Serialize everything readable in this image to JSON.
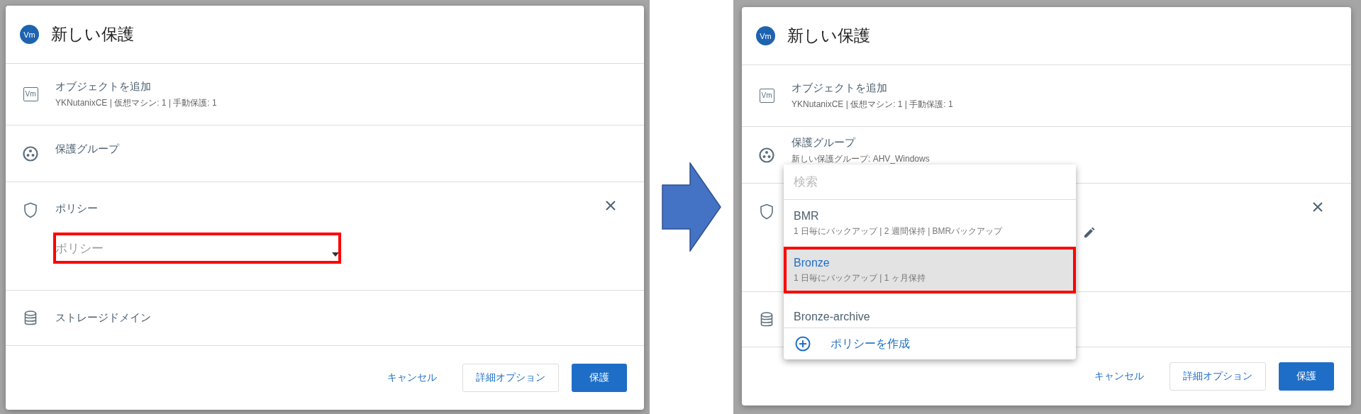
{
  "panels": [
    {
      "title": "新しい保護",
      "avatar": "Vm",
      "sections": [
        {
          "kind": "object",
          "badge": "Vm",
          "title": "オブジェクトを追加",
          "subtitle": "YKNutanixCE  |  仮想マシン: 1  |  手動保護: 1"
        },
        {
          "kind": "group",
          "title": "保護グループ"
        },
        {
          "kind": "policy",
          "title": "ポリシー",
          "closable": true,
          "field": {
            "placeholder": "ポリシー",
            "highlighted": true
          }
        },
        {
          "kind": "storage",
          "title": "ストレージドメイン"
        }
      ],
      "buttons": [
        {
          "label": "キャンセル",
          "kind": "link"
        },
        {
          "label": "詳細オプション",
          "kind": "outline"
        },
        {
          "label": "保護",
          "kind": "primary"
        }
      ]
    },
    {
      "title": "新しい保護",
      "avatar": "Vm",
      "sections": [
        {
          "kind": "object",
          "badge": "Vm",
          "title": "オブジェクトを追加",
          "subtitle": "YKNutanixCE  |  仮想マシン: 1  |  手動保護: 1"
        },
        {
          "kind": "group",
          "title": "保護グループ",
          "subtitle": "新しい保護グループ: AHV_Windows"
        },
        {
          "kind": "policy",
          "closable": true,
          "editable": true
        },
        {
          "kind": "storage"
        }
      ],
      "buttons": [
        {
          "label": "キャンセル",
          "kind": "link"
        },
        {
          "label": "詳細オプション",
          "kind": "outline"
        },
        {
          "label": "保護",
          "kind": "primary"
        }
      ],
      "dropdown": {
        "placeholder": "検索",
        "items": [
          {
            "name": "BMR",
            "detail": "1 日毎にバックアップ  |  2 週間保持  |  BMRバックアップ",
            "selected": false,
            "highlighted": false
          },
          {
            "name": "Bronze",
            "detail": "1 日毎にバックアップ  |  1 ヶ月保持",
            "selected": true,
            "highlighted": true
          },
          {
            "name": "Bronze-archive",
            "selected": false,
            "highlighted": false
          }
        ],
        "action": "ポリシーを作成"
      }
    }
  ]
}
